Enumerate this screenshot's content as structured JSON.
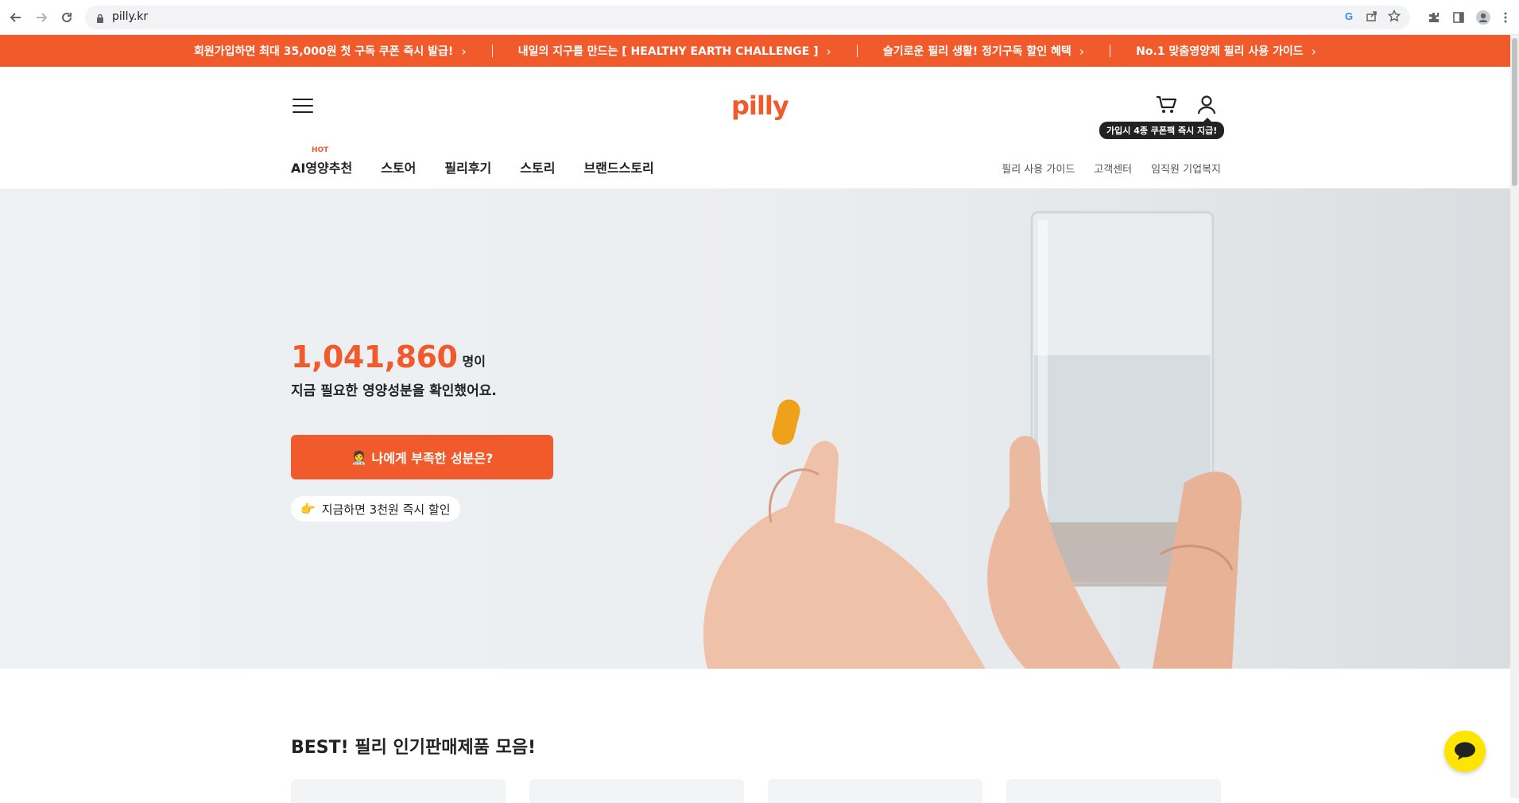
{
  "browser": {
    "url": "pilly.kr"
  },
  "promo_bar": {
    "items": [
      "회원가입하면 최대 35,000원 첫 구독 쿠폰 즉시 발급!",
      "내일의 지구를 만드는 [ HEALTHY EARTH CHALLENGE ]",
      "슬기로운 필리 생활! 정기구독 할인 혜택",
      "No.1 맞춤영양제 필리 사용 가이드"
    ],
    "background": "#f15a2b"
  },
  "header": {
    "logo": "pilly",
    "tooltip": "가입시 4종 쿠폰팩 즉시 지급!",
    "nav": {
      "hot_badge": "HOT",
      "items": [
        "AI영양추천",
        "스토어",
        "필리후기",
        "스토리",
        "브랜드스토리"
      ]
    },
    "util": [
      "필리 사용 가이드",
      "고객센터",
      "임직원 기업복지"
    ]
  },
  "hero": {
    "count": "1,041,860",
    "count_unit": "명이",
    "subtitle": "지금 필요한 영양성분을 확인했어요.",
    "cta_emoji": "🧑‍⚕️",
    "cta_label": "나에게 부족한 성분은?",
    "coupon_emoji": "👉",
    "coupon_text": "지금하면 3천원 즉시 할인"
  },
  "best": {
    "title": "BEST! 필리 인기판매제품 모음!"
  },
  "colors": {
    "brand": "#f15a2b",
    "chat": "#fee500"
  }
}
